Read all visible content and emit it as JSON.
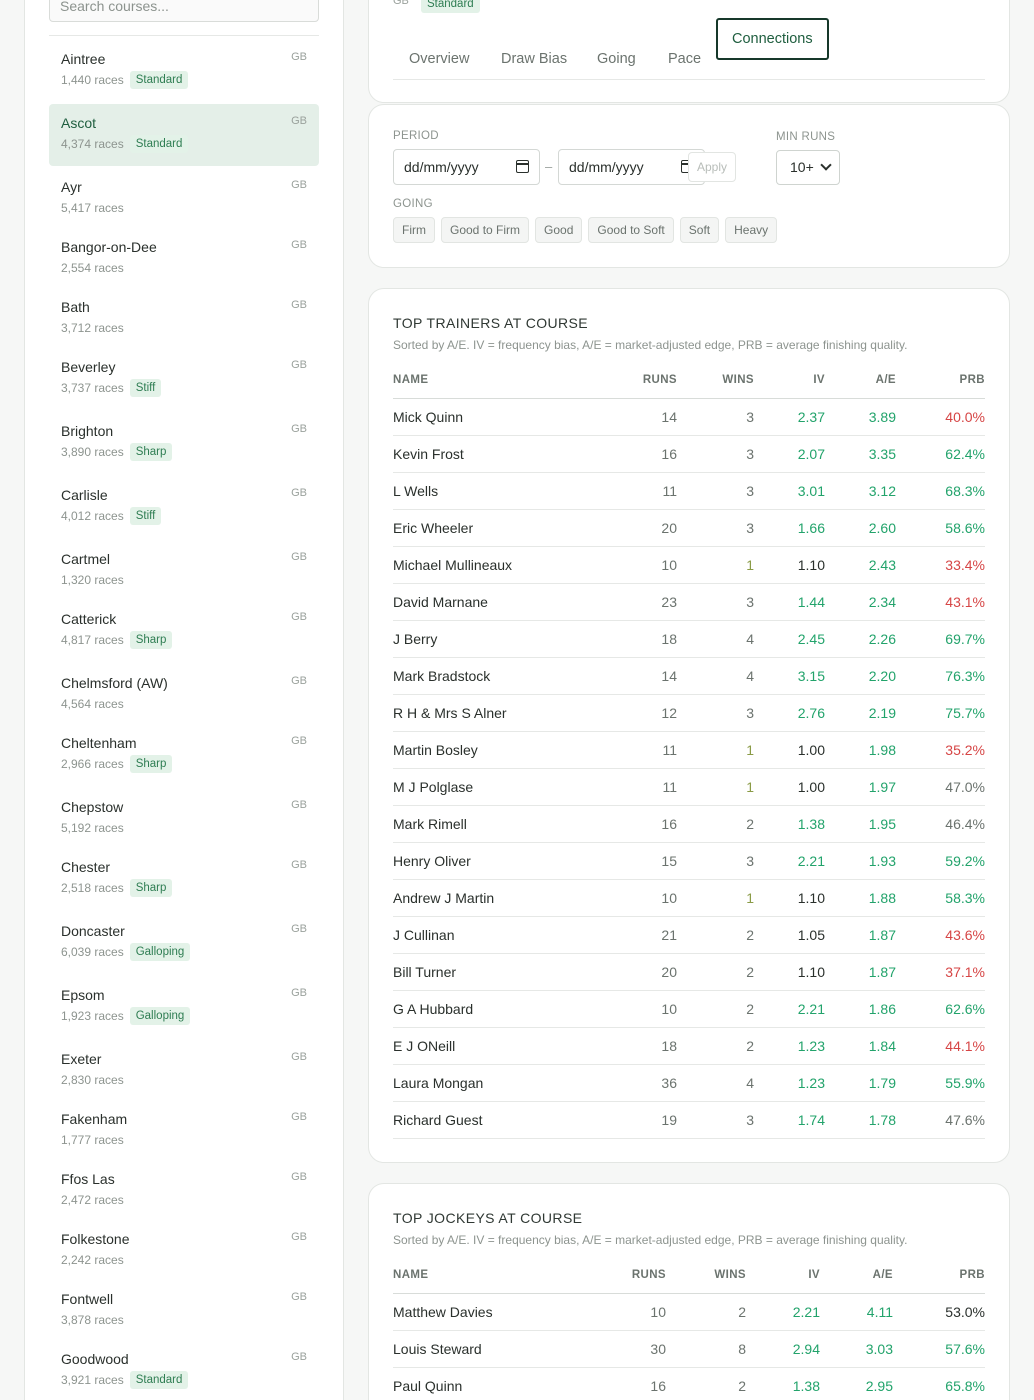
{
  "sidebar": {
    "search_placeholder": "Search courses...",
    "courses": [
      {
        "name": "Aintree",
        "country": "GB",
        "races": "1,440 races",
        "tag": "Standard"
      },
      {
        "name": "Ascot",
        "country": "GB",
        "races": "4,374 races",
        "tag": "Standard",
        "active": true
      },
      {
        "name": "Ayr",
        "country": "GB",
        "races": "5,417 races",
        "tag": ""
      },
      {
        "name": "Bangor-on-Dee",
        "country": "GB",
        "races": "2,554 races",
        "tag": ""
      },
      {
        "name": "Bath",
        "country": "GB",
        "races": "3,712 races",
        "tag": ""
      },
      {
        "name": "Beverley",
        "country": "GB",
        "races": "3,737 races",
        "tag": "Stiff"
      },
      {
        "name": "Brighton",
        "country": "GB",
        "races": "3,890 races",
        "tag": "Sharp"
      },
      {
        "name": "Carlisle",
        "country": "GB",
        "races": "4,012 races",
        "tag": "Stiff"
      },
      {
        "name": "Cartmel",
        "country": "GB",
        "races": "1,320 races",
        "tag": ""
      },
      {
        "name": "Catterick",
        "country": "GB",
        "races": "4,817 races",
        "tag": "Sharp"
      },
      {
        "name": "Chelmsford (AW)",
        "country": "GB",
        "races": "4,564 races",
        "tag": ""
      },
      {
        "name": "Cheltenham",
        "country": "GB",
        "races": "2,966 races",
        "tag": "Sharp"
      },
      {
        "name": "Chepstow",
        "country": "GB",
        "races": "5,192 races",
        "tag": ""
      },
      {
        "name": "Chester",
        "country": "GB",
        "races": "2,518 races",
        "tag": "Sharp"
      },
      {
        "name": "Doncaster",
        "country": "GB",
        "races": "6,039 races",
        "tag": "Galloping"
      },
      {
        "name": "Epsom",
        "country": "GB",
        "races": "1,923 races",
        "tag": "Galloping"
      },
      {
        "name": "Exeter",
        "country": "GB",
        "races": "2,830 races",
        "tag": ""
      },
      {
        "name": "Fakenham",
        "country": "GB",
        "races": "1,777 races",
        "tag": ""
      },
      {
        "name": "Ffos Las",
        "country": "GB",
        "races": "2,472 races",
        "tag": ""
      },
      {
        "name": "Folkestone",
        "country": "GB",
        "races": "2,242 races",
        "tag": ""
      },
      {
        "name": "Fontwell",
        "country": "GB",
        "races": "3,878 races",
        "tag": ""
      },
      {
        "name": "Goodwood",
        "country": "GB",
        "races": "3,921 races",
        "tag": "Standard"
      }
    ]
  },
  "header": {
    "country": "GB",
    "tag": "Standard",
    "tabs": [
      "Overview",
      "Draw Bias",
      "Going",
      "Pace",
      "Connections"
    ],
    "active_tab": "Connections"
  },
  "filters": {
    "period_label": "PERIOD",
    "date_from_placeholder": "dd/mm/yyyy",
    "date_to_placeholder": "dd/mm/yyyy",
    "apply_label": "Apply",
    "min_runs_label": "MIN RUNS",
    "min_runs_value": "10+",
    "going_label": "GOING",
    "going_options": [
      "Firm",
      "Good to Firm",
      "Good",
      "Good to Soft",
      "Soft",
      "Heavy"
    ]
  },
  "trainers": {
    "title": "TOP TRAINERS AT COURSE",
    "subtitle": "Sorted by A/E. IV = frequency bias, A/E = market-adjusted edge, PRB = average finishing quality.",
    "columns": [
      "NAME",
      "RUNS",
      "WINS",
      "IV",
      "A/E",
      "PRB"
    ],
    "rows": [
      {
        "name": "Mick Quinn",
        "runs": "14",
        "wins": "3",
        "iv": "2.37",
        "ae": "3.89",
        "prb": "40.0%"
      },
      {
        "name": "Kevin Frost",
        "runs": "16",
        "wins": "3",
        "iv": "2.07",
        "ae": "3.35",
        "prb": "62.4%"
      },
      {
        "name": "L Wells",
        "runs": "11",
        "wins": "3",
        "iv": "3.01",
        "ae": "3.12",
        "prb": "68.3%"
      },
      {
        "name": "Eric Wheeler",
        "runs": "20",
        "wins": "3",
        "iv": "1.66",
        "ae": "2.60",
        "prb": "58.6%"
      },
      {
        "name": "Michael Mullineaux",
        "runs": "10",
        "wins": "1",
        "iv": "1.10",
        "ae": "2.43",
        "prb": "33.4%"
      },
      {
        "name": "David Marnane",
        "runs": "23",
        "wins": "3",
        "iv": "1.44",
        "ae": "2.34",
        "prb": "43.1%"
      },
      {
        "name": "J Berry",
        "runs": "18",
        "wins": "4",
        "iv": "2.45",
        "ae": "2.26",
        "prb": "69.7%"
      },
      {
        "name": "Mark Bradstock",
        "runs": "14",
        "wins": "4",
        "iv": "3.15",
        "ae": "2.20",
        "prb": "76.3%"
      },
      {
        "name": "R H & Mrs S Alner",
        "runs": "12",
        "wins": "3",
        "iv": "2.76",
        "ae": "2.19",
        "prb": "75.7%"
      },
      {
        "name": "Martin Bosley",
        "runs": "11",
        "wins": "1",
        "iv": "1.00",
        "ae": "1.98",
        "prb": "35.2%"
      },
      {
        "name": "M J Polglase",
        "runs": "11",
        "wins": "1",
        "iv": "1.00",
        "ae": "1.97",
        "prb": "47.0%"
      },
      {
        "name": "Mark Rimell",
        "runs": "16",
        "wins": "2",
        "iv": "1.38",
        "ae": "1.95",
        "prb": "46.4%"
      },
      {
        "name": "Henry Oliver",
        "runs": "15",
        "wins": "3",
        "iv": "2.21",
        "ae": "1.93",
        "prb": "59.2%"
      },
      {
        "name": "Andrew J Martin",
        "runs": "10",
        "wins": "1",
        "iv": "1.10",
        "ae": "1.88",
        "prb": "58.3%"
      },
      {
        "name": "J Cullinan",
        "runs": "21",
        "wins": "2",
        "iv": "1.05",
        "ae": "1.87",
        "prb": "43.6%"
      },
      {
        "name": "Bill Turner",
        "runs": "20",
        "wins": "2",
        "iv": "1.10",
        "ae": "1.87",
        "prb": "37.1%"
      },
      {
        "name": "G A Hubbard",
        "runs": "10",
        "wins": "2",
        "iv": "2.21",
        "ae": "1.86",
        "prb": "62.6%"
      },
      {
        "name": "E J ONeill",
        "runs": "18",
        "wins": "2",
        "iv": "1.23",
        "ae": "1.84",
        "prb": "44.1%"
      },
      {
        "name": "Laura Mongan",
        "runs": "36",
        "wins": "4",
        "iv": "1.23",
        "ae": "1.79",
        "prb": "55.9%"
      },
      {
        "name": "Richard Guest",
        "runs": "19",
        "wins": "3",
        "iv": "1.74",
        "ae": "1.78",
        "prb": "47.6%"
      }
    ]
  },
  "jockeys": {
    "title": "TOP JOCKEYS AT COURSE",
    "subtitle": "Sorted by A/E. IV = frequency bias, A/E = market-adjusted edge, PRB = average finishing quality.",
    "columns": [
      "NAME",
      "RUNS",
      "WINS",
      "IV",
      "A/E",
      "PRB"
    ],
    "rows": [
      {
        "name": "Matthew Davies",
        "runs": "10",
        "wins": "2",
        "iv": "2.21",
        "ae": "4.11",
        "prb": "53.0%"
      },
      {
        "name": "Louis Steward",
        "runs": "30",
        "wins": "8",
        "iv": "2.94",
        "ae": "3.03",
        "prb": "57.6%"
      },
      {
        "name": "Paul Quinn",
        "runs": "16",
        "wins": "2",
        "iv": "1.38",
        "ae": "2.95",
        "prb": "65.8%"
      }
    ]
  },
  "colors": {
    "positive": "#22a36b",
    "negative": "#d64545",
    "accent": "#1f5e3f",
    "active_bg": "#e4efe8"
  }
}
